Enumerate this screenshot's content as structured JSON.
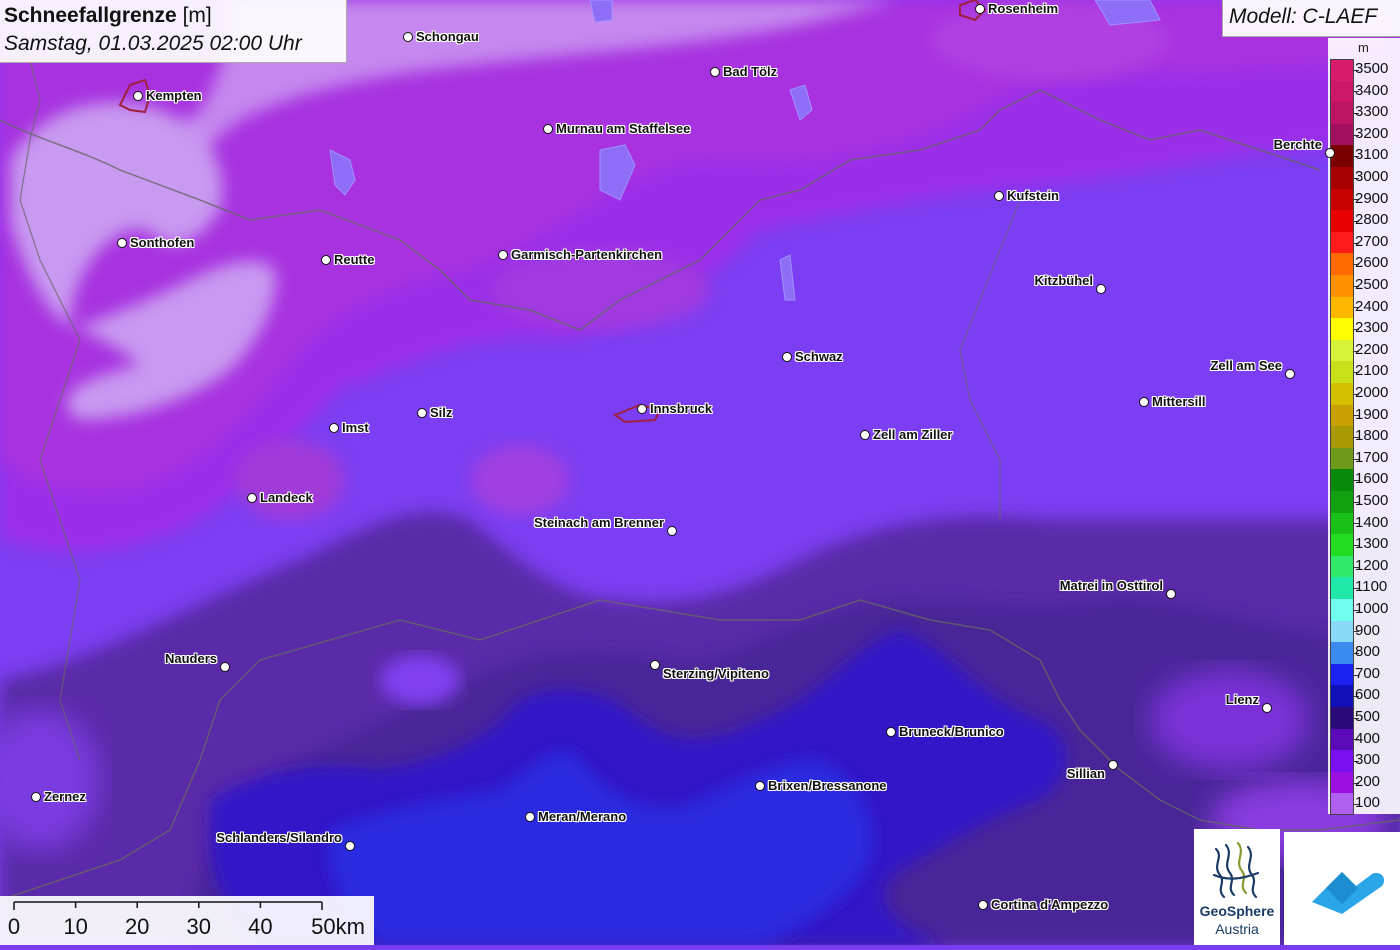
{
  "title": {
    "main": "Schneefallgrenze",
    "unit": "[m]",
    "datetime": "Samstag, 01.03.2025 02:00 Uhr"
  },
  "model": "Modell: C-LAEF",
  "legend": {
    "unit": "m",
    "entries": [
      {
        "value": "3500",
        "color": "#d81b6a"
      },
      {
        "value": "3400",
        "color": "#cc1866"
      },
      {
        "value": "3300",
        "color": "#bd1466"
      },
      {
        "value": "3200",
        "color": "#a31060"
      },
      {
        "value": "3100",
        "color": "#7a0000"
      },
      {
        "value": "3000",
        "color": "#a80000"
      },
      {
        "value": "2900",
        "color": "#c80000"
      },
      {
        "value": "2800",
        "color": "#e80000"
      },
      {
        "value": "2700",
        "color": "#ff1a1a"
      },
      {
        "value": "2600",
        "color": "#ff6a00"
      },
      {
        "value": "2500",
        "color": "#ff9000"
      },
      {
        "value": "2400",
        "color": "#ffb800"
      },
      {
        "value": "2300",
        "color": "#ffff00"
      },
      {
        "value": "2200",
        "color": "#d8f23a"
      },
      {
        "value": "2100",
        "color": "#c8e01a"
      },
      {
        "value": "2000",
        "color": "#d4c000"
      },
      {
        "value": "1900",
        "color": "#c8a000"
      },
      {
        "value": "1800",
        "color": "#a89a00"
      },
      {
        "value": "1700",
        "color": "#6e9a1c"
      },
      {
        "value": "1600",
        "color": "#0a8a0a"
      },
      {
        "value": "1500",
        "color": "#10a010"
      },
      {
        "value": "1400",
        "color": "#18c018"
      },
      {
        "value": "1300",
        "color": "#22dc22"
      },
      {
        "value": "1200",
        "color": "#30e86a"
      },
      {
        "value": "1100",
        "color": "#20e8a8"
      },
      {
        "value": "1000",
        "color": "#70ffee"
      },
      {
        "value": "900",
        "color": "#88d8f8"
      },
      {
        "value": "800",
        "color": "#3c8cf0"
      },
      {
        "value": "700",
        "color": "#1a20f0"
      },
      {
        "value": "600",
        "color": "#1010b8"
      },
      {
        "value": "500",
        "color": "#2a0a78"
      },
      {
        "value": "400",
        "color": "#5a0ab8"
      },
      {
        "value": "300",
        "color": "#7a10f0"
      },
      {
        "value": "200",
        "color": "#9a10e0"
      },
      {
        "value": "100",
        "color": "#b060f0"
      }
    ]
  },
  "towns": [
    {
      "name": "Rosenheim"
    },
    {
      "name": "Schongau"
    },
    {
      "name": "Kempten"
    },
    {
      "name": "Bad Tölz"
    },
    {
      "name": "Murnau am Staffelsee"
    },
    {
      "name": "Berchte"
    },
    {
      "name": "Kufstein"
    },
    {
      "name": "Sonthofen"
    },
    {
      "name": "Reutte"
    },
    {
      "name": "Garmisch-Partenkirchen"
    },
    {
      "name": "Kitzbühel"
    },
    {
      "name": "Schwaz"
    },
    {
      "name": "Zell am See"
    },
    {
      "name": "Mittersill"
    },
    {
      "name": "Silz"
    },
    {
      "name": "Innsbruck"
    },
    {
      "name": "Imst"
    },
    {
      "name": "Zell am Ziller"
    },
    {
      "name": "Landeck"
    },
    {
      "name": "Steinach am Brenner"
    },
    {
      "name": "Matrei in Osttirol"
    },
    {
      "name": "Nauders"
    },
    {
      "name": "Sterzing/Vipiteno"
    },
    {
      "name": "Lienz"
    },
    {
      "name": "Bruneck/Brunico"
    },
    {
      "name": "Sillian"
    },
    {
      "name": "Brixen/Bressanone"
    },
    {
      "name": "Zernez"
    },
    {
      "name": "Meran/Merano"
    },
    {
      "name": "Schlanders/Silandro"
    },
    {
      "name": "Cortina d'Ampezzo"
    }
  ],
  "scale": {
    "labels": [
      "0",
      "10",
      "20",
      "30",
      "40",
      "50km"
    ]
  },
  "logos": {
    "geosphere_line1": "GeoSphere",
    "geosphere_line2": "Austria"
  }
}
